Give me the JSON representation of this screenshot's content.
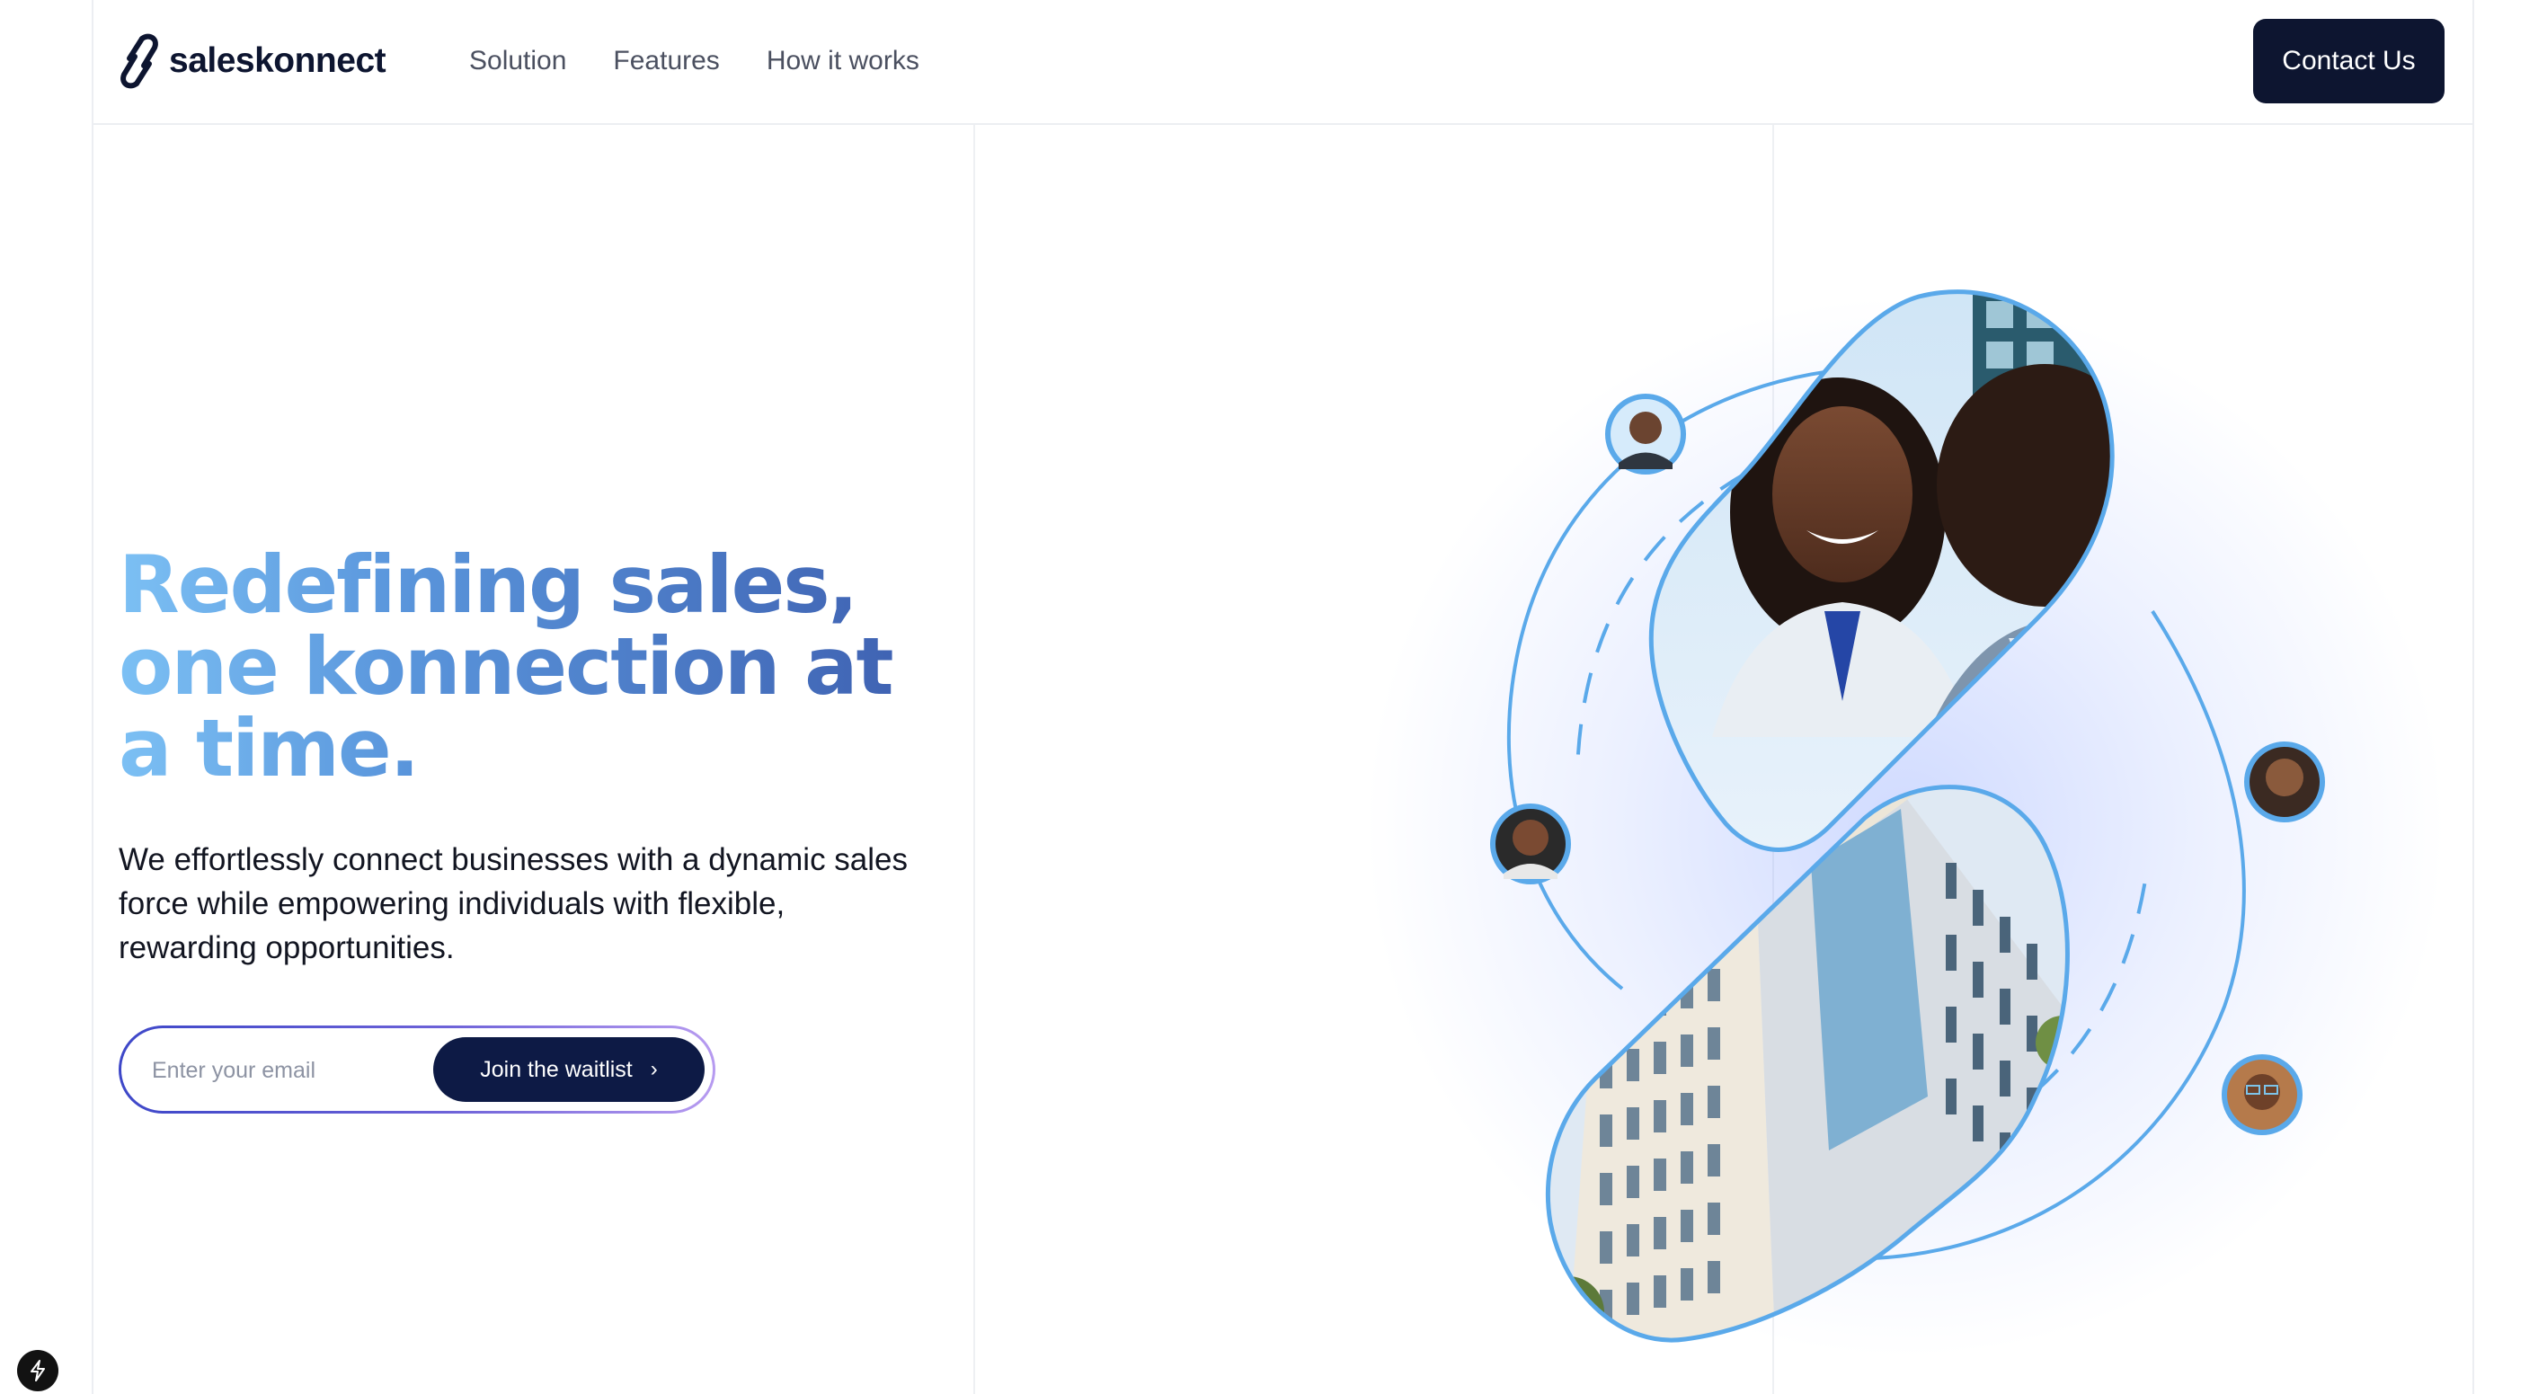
{
  "brand": {
    "name": "saleskonnect"
  },
  "nav": {
    "items": [
      "Solution",
      "Features",
      "How it works"
    ],
    "contact_label": "Contact Us"
  },
  "hero": {
    "headline": "Redefining sales, one konnection at a time.",
    "subtext": "We effortlessly connect businesses with a dynamic sales force while empowering individuals with flexible, rewarding opportunities.",
    "email_placeholder": "Enter your email",
    "cta_label": "Join the waitlist",
    "cta_icon": "chevron-right-icon"
  },
  "illustration": {
    "photo_subjects": [
      "smiling-woman-and-man",
      "office-building"
    ],
    "avatars": [
      "avatar-man-suit",
      "avatar-woman-1",
      "avatar-woman-2",
      "avatar-woman-glasses"
    ]
  },
  "colors": {
    "navy": "#0d1530",
    "headline_gradient_start": "#7cc0f4",
    "headline_gradient_end": "#3f62b2",
    "accent_blue": "#5aa9ea"
  }
}
